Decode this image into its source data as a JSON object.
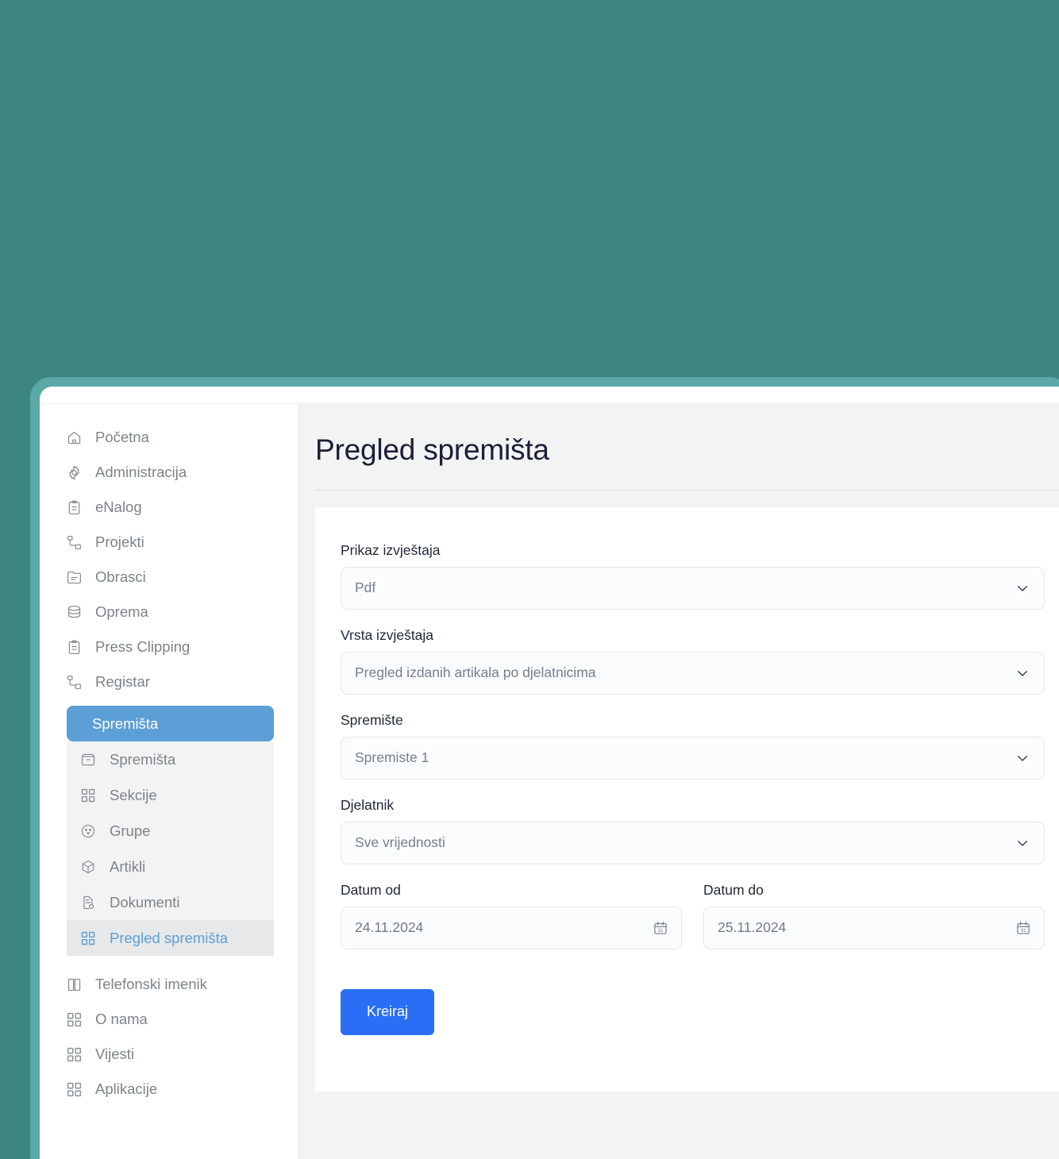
{
  "theme": {
    "desktop_background": "#3d8583",
    "window_frame": "#5aa9a7",
    "accent_blue": "#5b9fd6",
    "button_blue": "#2a6ef5",
    "content_background": "#f2f3f3"
  },
  "sidebar": {
    "top_items": [
      {
        "label": "Početna",
        "icon": "home-icon"
      },
      {
        "label": "Administracija",
        "icon": "gear-icon"
      },
      {
        "label": "eNalog",
        "icon": "clipboard-icon"
      },
      {
        "label": "Projekti",
        "icon": "flow-icon"
      },
      {
        "label": "Obrasci",
        "icon": "form-icon"
      },
      {
        "label": "Oprema",
        "icon": "database-icon"
      },
      {
        "label": "Press Clipping",
        "icon": "clipboard-icon"
      },
      {
        "label": "Registar",
        "icon": "flow-icon"
      }
    ],
    "active_parent": {
      "label": "Spremišta",
      "icon": "archive-icon"
    },
    "submenu": [
      {
        "label": "Spremišta",
        "icon": "archive-icon",
        "active": false
      },
      {
        "label": "Sekcije",
        "icon": "grid-icon",
        "active": false
      },
      {
        "label": "Grupe",
        "icon": "circle-dots-icon",
        "active": false
      },
      {
        "label": "Artikli",
        "icon": "box-icon",
        "active": false
      },
      {
        "label": "Dokumenti",
        "icon": "document-icon",
        "active": false
      },
      {
        "label": "Pregled spremišta",
        "icon": "grid-icon",
        "active": true
      }
    ],
    "bottom_items": [
      {
        "label": "Telefonski imenik",
        "icon": "book-icon"
      },
      {
        "label": "O nama",
        "icon": "grid-icon"
      },
      {
        "label": "Vijesti",
        "icon": "grid-icon"
      },
      {
        "label": "Aplikacije",
        "icon": "grid-icon"
      }
    ]
  },
  "page": {
    "title": "Pregled spremišta"
  },
  "form": {
    "report_format": {
      "label": "Prikaz izvještaja",
      "value": "Pdf",
      "icon": "chevron-down-icon"
    },
    "report_type": {
      "label": "Vrsta izvještaja",
      "value": "Pregled izdanih artikala po djelatnicima",
      "icon": "chevron-down-icon"
    },
    "storage": {
      "label": "Spremište",
      "value": "Spremiste 1",
      "icon": "chevron-down-icon"
    },
    "employee": {
      "label": "Djelatnik",
      "value": "Sve vrijednosti",
      "icon": "chevron-down-icon"
    },
    "date_from": {
      "label": "Datum od",
      "value": "24.11.2024",
      "icon": "calendar-icon"
    },
    "date_to": {
      "label": "Datum do",
      "value": "25.11.2024",
      "icon": "calendar-icon"
    },
    "submit": {
      "label": "Kreiraj"
    }
  }
}
